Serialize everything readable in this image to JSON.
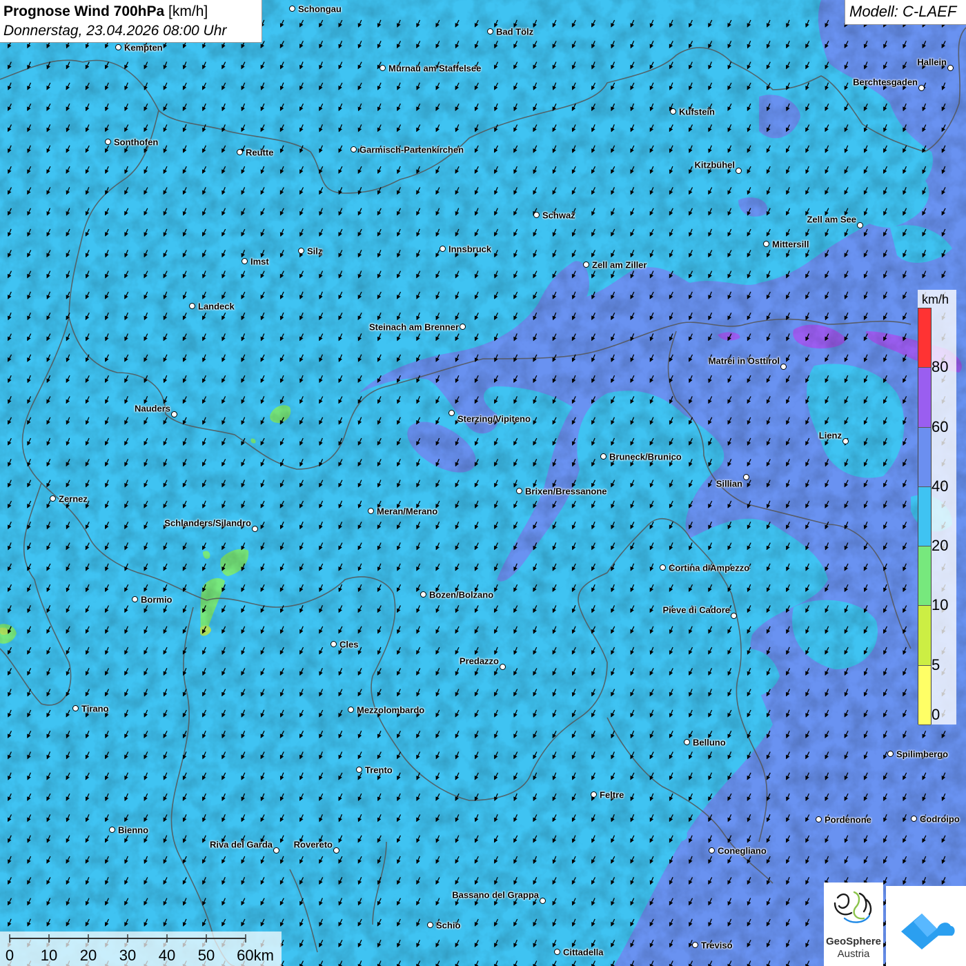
{
  "title": {
    "main": "Prognose Wind 700hPa",
    "unit": "[km/h]",
    "datetime": "Donnerstag, 23.04.2026 08:00 Uhr"
  },
  "model": {
    "label": "Modell: C-LAEF"
  },
  "legend": {
    "unit": "km/h",
    "bands": [
      {
        "from": 0,
        "to": 5,
        "color": "#ffff66"
      },
      {
        "from": 5,
        "to": 10,
        "color": "#ccee44"
      },
      {
        "from": 10,
        "to": 20,
        "color": "#77e87d"
      },
      {
        "from": 20,
        "to": 40,
        "color": "#3fc3f2"
      },
      {
        "from": 40,
        "to": 60,
        "color": "#6b8ff0"
      },
      {
        "from": 60,
        "to": 80,
        "color": "#9a5ef0"
      },
      {
        "from": 80,
        "to": null,
        "color": "#ff3333"
      }
    ],
    "ticks": [
      "80",
      "60",
      "40",
      "20",
      "10",
      "5",
      "0"
    ]
  },
  "scalebar": {
    "ticks": [
      "0",
      "10",
      "20",
      "30",
      "40",
      "50",
      "60km"
    ]
  },
  "logos": {
    "geosphere_line1": "GeoSphere",
    "geosphere_line2": "Austria"
  },
  "wind": {
    "direction": "from north-east",
    "speed_range_kmh": "20-40"
  },
  "cities": [
    {
      "name": "Schongau"
    },
    {
      "name": "Bad Tölz"
    },
    {
      "name": "Kempten"
    },
    {
      "name": "Murnau am Staffelsee"
    },
    {
      "name": "Hallein"
    },
    {
      "name": "Berchtesgaden"
    },
    {
      "name": "Kufstein"
    },
    {
      "name": "Sonthofen"
    },
    {
      "name": "Reutte"
    },
    {
      "name": "Garmisch-Partenkirchen"
    },
    {
      "name": "Kitzbühel"
    },
    {
      "name": "Schwaz"
    },
    {
      "name": "Zell am See"
    },
    {
      "name": "Mittersill"
    },
    {
      "name": "Innsbruck"
    },
    {
      "name": "Silz"
    },
    {
      "name": "Imst"
    },
    {
      "name": "Zell am Ziller"
    },
    {
      "name": "Landeck"
    },
    {
      "name": "Steinach am Brenner"
    },
    {
      "name": "Matrei in Osttirol"
    },
    {
      "name": "Nauders"
    },
    {
      "name": "Sterzing/Vipiteno"
    },
    {
      "name": "Lienz"
    },
    {
      "name": "Bruneck/Brunico"
    },
    {
      "name": "Sillian"
    },
    {
      "name": "Brixen/Bressanone"
    },
    {
      "name": "Zernez"
    },
    {
      "name": "Meran/Merano"
    },
    {
      "name": "Schlanders/Silandro"
    },
    {
      "name": "Cortina d'Ampezzo"
    },
    {
      "name": "Bozen/Bolzano"
    },
    {
      "name": "Bormio"
    },
    {
      "name": "Pieve di Cadore"
    },
    {
      "name": "Cles"
    },
    {
      "name": "Predazzo"
    },
    {
      "name": "Tirano"
    },
    {
      "name": "Mezzolombardo"
    },
    {
      "name": "Belluno"
    },
    {
      "name": "Spilimbergo"
    },
    {
      "name": "Trento"
    },
    {
      "name": "Feltre"
    },
    {
      "name": "Bienno"
    },
    {
      "name": "Pordenone"
    },
    {
      "name": "Codroipo"
    },
    {
      "name": "Riva del Garda"
    },
    {
      "name": "Rovereto"
    },
    {
      "name": "Conegliano"
    },
    {
      "name": "Bassano del Grappa"
    },
    {
      "name": "Schio"
    },
    {
      "name": "Treviso"
    },
    {
      "name": "Cittadella"
    }
  ]
}
